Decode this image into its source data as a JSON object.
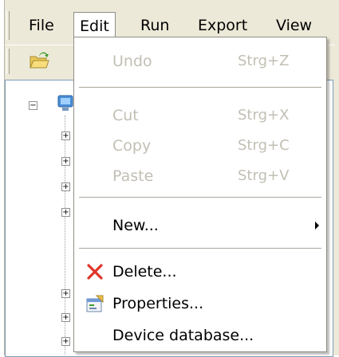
{
  "menubar": {
    "items": [
      {
        "label": "File"
      },
      {
        "label": "Edit"
      },
      {
        "label": "Run"
      },
      {
        "label": "Export"
      },
      {
        "label": "View"
      }
    ],
    "active": "Edit"
  },
  "edit_menu": {
    "items": [
      {
        "label": "Undo",
        "shortcut": "Strg+Z",
        "enabled": false
      },
      {
        "label": "Cut",
        "shortcut": "Strg+X",
        "enabled": false
      },
      {
        "label": "Copy",
        "shortcut": "Strg+C",
        "enabled": false
      },
      {
        "label": "Paste",
        "shortcut": "Strg+V",
        "enabled": false
      },
      {
        "label": "New...",
        "shortcut": "",
        "enabled": true,
        "submenu": true
      },
      {
        "label": "Delete...",
        "shortcut": "",
        "enabled": true,
        "icon": "red-x-delete-icon"
      },
      {
        "label": "Properties...",
        "shortcut": "",
        "enabled": true,
        "icon": "properties-icon"
      },
      {
        "label": "Device database...",
        "shortcut": "",
        "enabled": true
      }
    ]
  },
  "icons": {
    "toolbar": "open-folder-icon",
    "tree_root": "network-computer-icon"
  },
  "colors": {
    "menubar_bg": "#ece9d8",
    "menu_bg": "#ffffff",
    "disabled_text": "#c2bfb4",
    "delete_icon": "#e0342a"
  }
}
